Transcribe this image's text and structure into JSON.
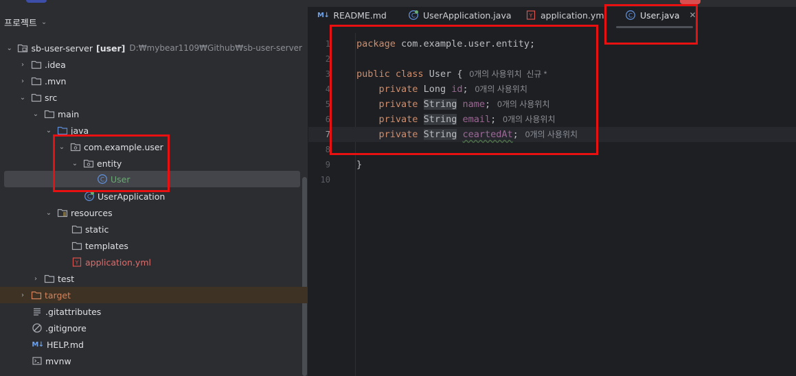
{
  "project_panel": {
    "title": "프로젝트",
    "tree": [
      {
        "label": "sb-user-server",
        "suffix": "[user]",
        "path": "D:₩mybear1109₩Github₩sb-user-server"
      },
      {
        "label": ".idea"
      },
      {
        "label": ".mvn"
      },
      {
        "label": "src"
      },
      {
        "label": "main"
      },
      {
        "label": "java"
      },
      {
        "label": "com.example.user"
      },
      {
        "label": "entity"
      },
      {
        "label": "User"
      },
      {
        "label": "UserApplication"
      },
      {
        "label": "resources"
      },
      {
        "label": "static"
      },
      {
        "label": "templates"
      },
      {
        "label": "application.yml"
      },
      {
        "label": "test"
      },
      {
        "label": "target"
      },
      {
        "label": ".gitattributes"
      },
      {
        "label": ".gitignore"
      },
      {
        "label": "HELP.md"
      },
      {
        "label": "mvnw"
      }
    ]
  },
  "tabs": [
    {
      "label": "README.md",
      "icon": "markdown-icon",
      "icon_text": "M↓"
    },
    {
      "label": "UserApplication.java",
      "icon": "spring-class-icon"
    },
    {
      "label": "application.yml",
      "icon": "yaml-icon",
      "icon_text": "Y"
    },
    {
      "label": "User.java",
      "icon": "class-icon",
      "active": true
    }
  ],
  "editor": {
    "line_numbers": [
      "1",
      "2",
      "3",
      "4",
      "5",
      "6",
      "7",
      "8",
      "9",
      "10"
    ],
    "current_line": "7",
    "lines": {
      "l1_kw": "package",
      "l1_rest": " com.example.user.entity;",
      "l3_kw1": "public",
      "l3_kw2": "class",
      "l3_rest": " User {",
      "l3_hint": "0개의 사용위치  신규 *",
      "l4_kw": "private",
      "l4_type": "Long",
      "l4_field": "id",
      "l4_hint": "0개의 사용위치",
      "l5_kw": "private",
      "l5_type": "String",
      "l5_field": "name",
      "l5_hint": "0개의 사용위치",
      "l6_kw": "private",
      "l6_type": "String",
      "l6_field": "email",
      "l6_hint": "0개의 사용위치",
      "l7_kw": "private",
      "l7_type": "String",
      "l7_field": "ceartedAt",
      "l7_hint": "0개의 사용위치",
      "l9": "}",
      "semicolon": ";"
    }
  },
  "colors": {
    "keyword": "#cf8e6d",
    "field": "#c77dbb",
    "highlight_box": "#e81010",
    "excluded_folder": "#d6845d"
  }
}
